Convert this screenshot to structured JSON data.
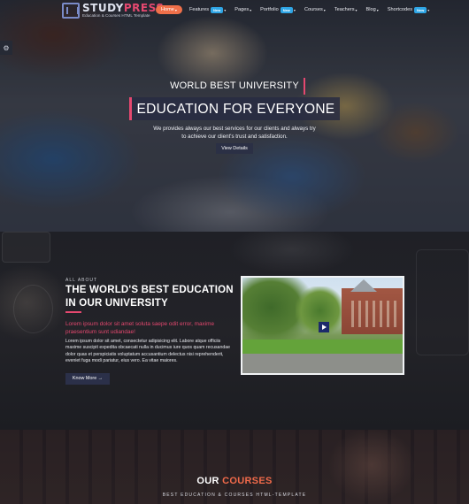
{
  "logo": {
    "name_part1": "STUDY",
    "name_part2": "PRESS",
    "tagline": "Education & Courses HTML Template"
  },
  "nav": {
    "items": [
      {
        "label": "Home",
        "active": true,
        "badge": ""
      },
      {
        "label": "Features",
        "active": false,
        "badge": "New"
      },
      {
        "label": "Pages",
        "active": false,
        "badge": ""
      },
      {
        "label": "Portfolio",
        "active": false,
        "badge": "New"
      },
      {
        "label": "Courses",
        "active": false,
        "badge": ""
      },
      {
        "label": "Teachers",
        "active": false,
        "badge": ""
      },
      {
        "label": "Blog",
        "active": false,
        "badge": ""
      },
      {
        "label": "Shortcodes",
        "active": false,
        "badge": "New"
      }
    ]
  },
  "hero": {
    "kicker": "WORLD BEST UNIVERSITY",
    "title": "EDUCATION FOR EVERYONE",
    "description": "We provides always our best services for our clients and always try to achieve our client's trust and satisfaction.",
    "button_label": "View Details"
  },
  "about": {
    "kicker": "ALL ABOUT",
    "title": "THE WORLD'S BEST EDUCATION IN OUR UNIVERSITY",
    "lead": "Lorem ipsum dolor sit amet soluta saepe odit error, maxime praesentium sunt udiandae!",
    "body": "Lorem ipsum dolor sit amet, consectetur adipisicing elit. Labore atque officiis maxime suscipit expedita obcaecati nulla in ducimus iure quos quam recusandae dolor quas et perspiciatis voluptatum accusantium delectus nisi reprehenderit, eveniet fuga modi pariatur, eius vero. Ea vitae maiores.",
    "button_label": "Know More →"
  },
  "courses": {
    "title_part1": "OUR ",
    "title_part2": "COURSES",
    "subtitle": "BEST EDUCATION & COURSES HTML-TEMPLATE"
  },
  "icons": {
    "side_tab": "settings-icon",
    "video_play": "play-icon"
  },
  "colors": {
    "accent_pink": "#e4486f",
    "accent_orange": "#f0704a",
    "badge_blue": "#2fa6e6",
    "button_navy": "#2b3045"
  }
}
